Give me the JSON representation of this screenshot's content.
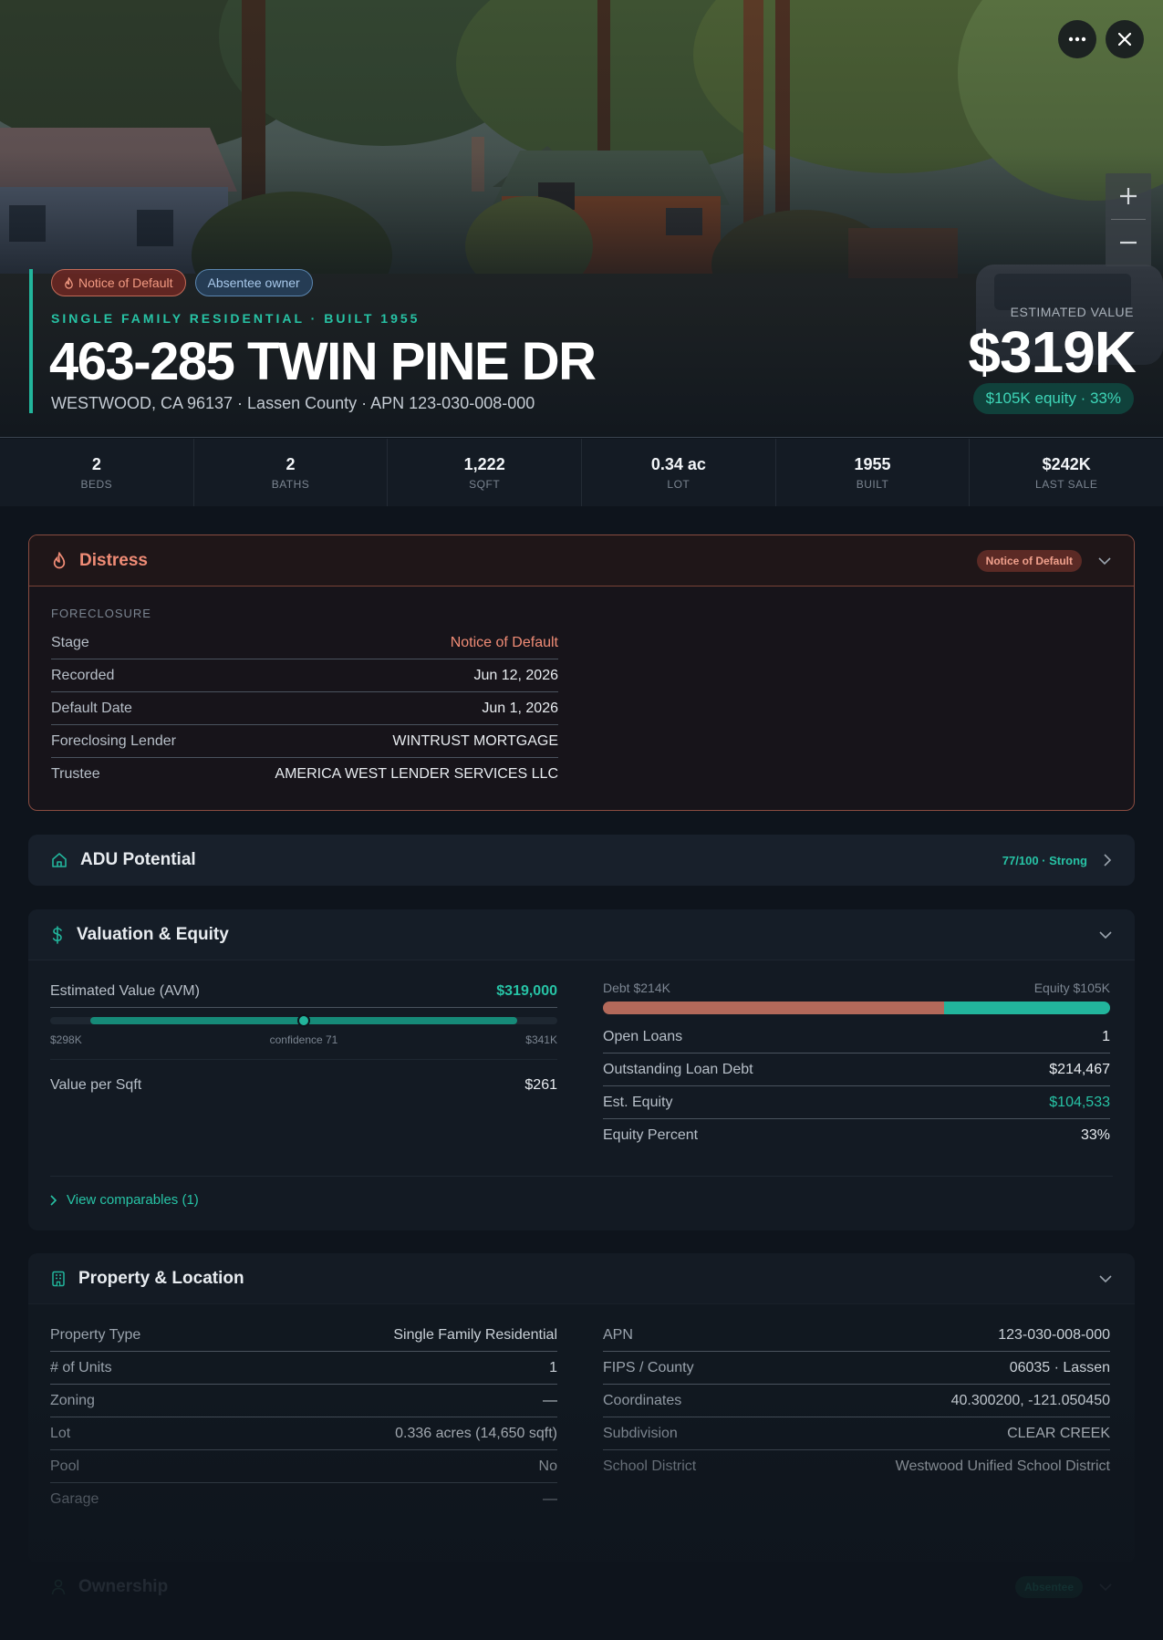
{
  "hero": {
    "tags": [
      "Notice of Default",
      "Absentee owner"
    ],
    "subtitle": "SINGLE FAMILY RESIDENTIAL · BUILT 1955",
    "address": "463-285 TWIN PINE DR",
    "location": "WESTWOOD, CA 96137 · Lassen County · APN 123-030-008-000",
    "estimated_label": "ESTIMATED VALUE",
    "estimated_value": "$319K",
    "equity": "$105K equity · 33%"
  },
  "stats": [
    {
      "value": "2",
      "label": "BEDS"
    },
    {
      "value": "2",
      "label": "BATHS"
    },
    {
      "value": "1,222",
      "label": "SQFT"
    },
    {
      "value": "0.34 ac",
      "label": "LOT"
    },
    {
      "value": "1955",
      "label": "BUILT"
    },
    {
      "value": "$242K",
      "label": "LAST SALE"
    }
  ],
  "distress": {
    "title": "Distress",
    "badge": "Notice of Default",
    "section_label": "FORECLOSURE",
    "rows": [
      {
        "k": "Stage",
        "v": "Notice of Default"
      },
      {
        "k": "Recorded",
        "v": "Jun 12, 2026"
      },
      {
        "k": "Default Date",
        "v": "Jun 1, 2026"
      },
      {
        "k": "Foreclosing Lender",
        "v": "WINTRUST MORTGAGE"
      },
      {
        "k": "Trustee",
        "v": "AMERICA WEST LENDER SERVICES LLC"
      }
    ]
  },
  "adu": {
    "title": "ADU Potential",
    "score": "77/100 · Strong"
  },
  "valuation": {
    "title": "Valuation & Equity",
    "avm_label": "Estimated Value (AVM)",
    "avm_value": "$319,000",
    "range_low": "$298K",
    "range_high": "$341K",
    "confidence": "confidence 71",
    "range_fill_start": 0.08,
    "range_fill_end": 0.92,
    "range_marker": 0.5,
    "vps_label": "Value per Sqft",
    "vps_value": "$261",
    "debt_label": "Debt $214K",
    "equity_label": "Equity $105K",
    "debt_fraction": 0.672,
    "rows": [
      {
        "k": "Open Loans",
        "v": "1"
      },
      {
        "k": "Outstanding Loan Debt",
        "v": "$214,467"
      },
      {
        "k": "Est. Equity",
        "v": "$104,533"
      },
      {
        "k": "Equity Percent",
        "v": "33%"
      }
    ],
    "comparables": "View comparables (1)"
  },
  "property": {
    "title": "Property & Location",
    "left": [
      {
        "k": "Property Type",
        "v": "Single Family Residential"
      },
      {
        "k": "# of Units",
        "v": "1"
      },
      {
        "k": "Zoning",
        "v": "—"
      },
      {
        "k": "Lot",
        "v": "0.336 acres (14,650 sqft)"
      },
      {
        "k": "Pool",
        "v": "No"
      },
      {
        "k": "Garage",
        "v": "—"
      }
    ],
    "right": [
      {
        "k": "APN",
        "v": "123-030-008-000"
      },
      {
        "k": "FIPS / County",
        "v": "06035 · Lassen"
      },
      {
        "k": "Coordinates",
        "v": "40.300200, -121.050450"
      },
      {
        "k": "Subdivision",
        "v": "CLEAR CREEK"
      },
      {
        "k": "School District",
        "v": "Westwood Unified School District"
      }
    ]
  },
  "ownership": {
    "title": "Ownership",
    "badge": "Absentee"
  },
  "colors": {
    "accent": "#22b59c",
    "distress": "#f08c76",
    "debt": "#b3695a"
  }
}
